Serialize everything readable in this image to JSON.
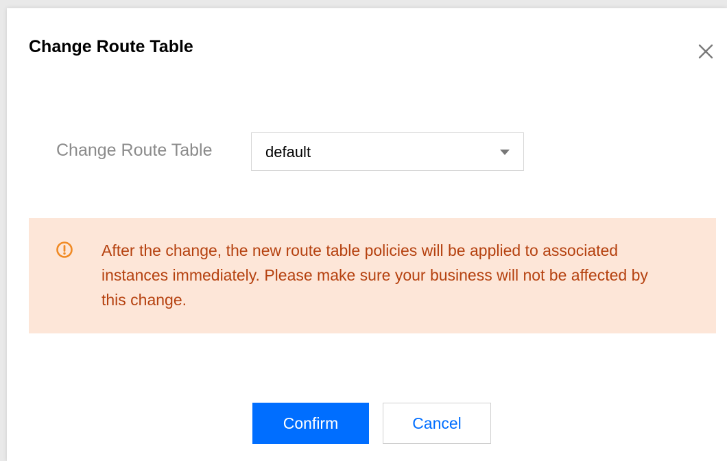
{
  "dialog": {
    "title": "Change Route Table"
  },
  "form": {
    "label": "Change Route Table",
    "select_value": "default"
  },
  "alert": {
    "message": "After the change, the new route table policies will be applied to associated instances immediately. Please make sure your business will not be affected by this change."
  },
  "footer": {
    "confirm_label": "Confirm",
    "cancel_label": "Cancel"
  },
  "colors": {
    "primary": "#006eff",
    "alert_bg": "#fde6d8",
    "alert_text": "#b5410f",
    "warning_icon": "#f08a24"
  }
}
